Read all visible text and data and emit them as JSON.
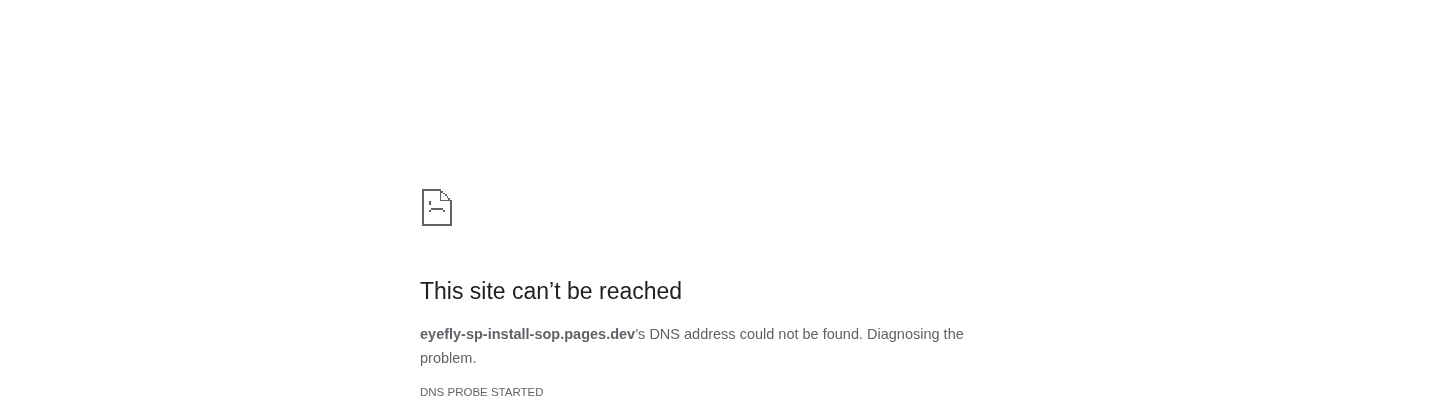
{
  "error_page": {
    "heading": "This site can’t be reached",
    "message": "**eyefly-sp-install-sop.pages.dev**’s DNS address could not be found. Diagnosing the problem.",
    "error_code": "DNS PROBE STARTED"
  }
}
